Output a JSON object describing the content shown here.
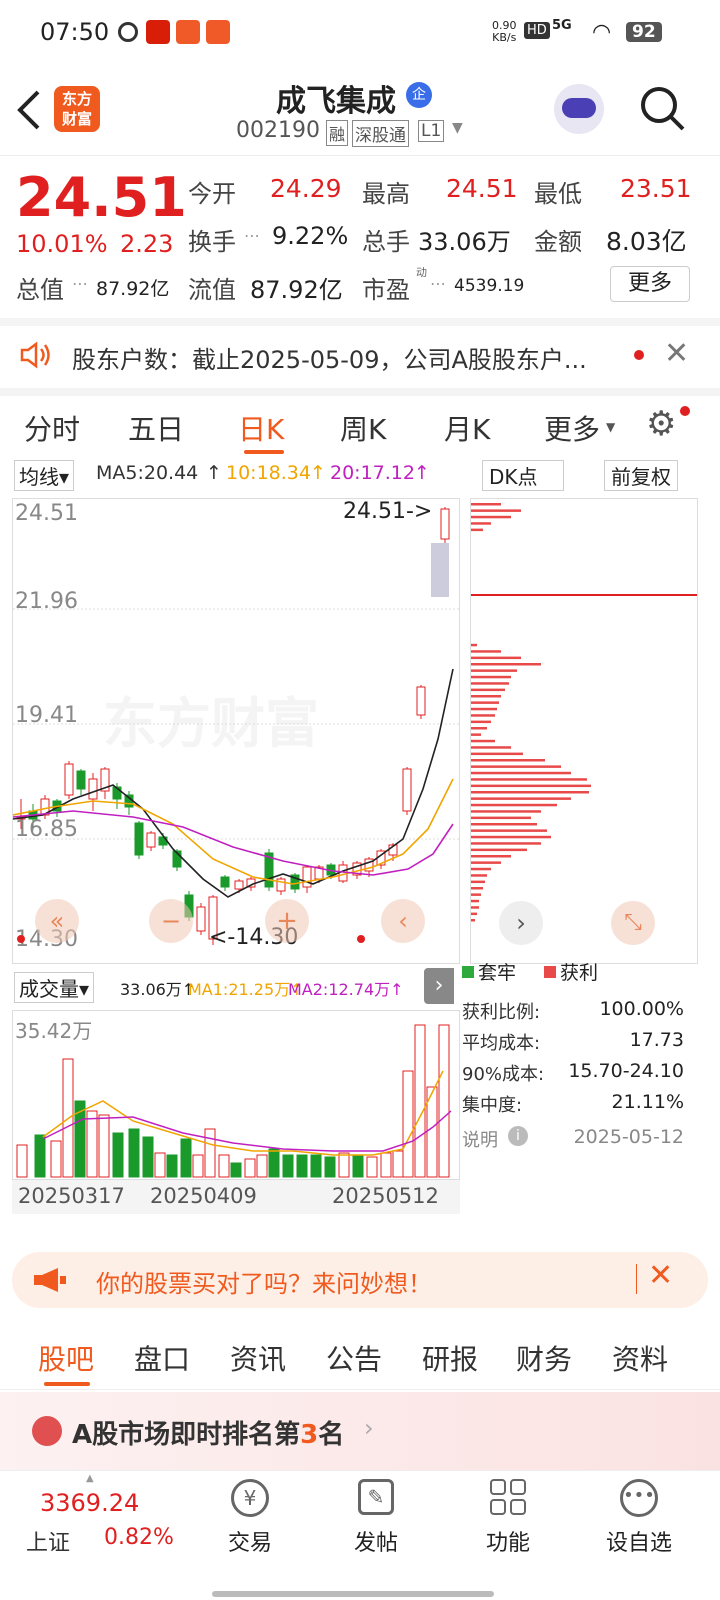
{
  "status": {
    "time": "07:50",
    "speed": "0.90",
    "speed_unit": "KB/s",
    "battery": "92",
    "net": "5G",
    "hd": "HD"
  },
  "header": {
    "logo_line1": "东方",
    "logo_line2": "财富",
    "title": "成飞集成",
    "title_badge": "企",
    "code": "002190",
    "tag1": "融",
    "tag2": "深股通",
    "tag3": "L1"
  },
  "quote": {
    "price": "24.51",
    "pct": "10.01%",
    "chg": "2.23",
    "open_label": "今开",
    "open": "24.29",
    "high_label": "最高",
    "high": "24.51",
    "low_label": "最低",
    "low": "23.51",
    "turnover_label": "换手",
    "turnover": "9.22%",
    "vol_label": "总手",
    "vol": "33.06万",
    "amt_label": "金额",
    "amt": "8.03亿",
    "mcap_label": "总值",
    "mcap": "87.92亿",
    "float_label": "流值",
    "float": "87.92亿",
    "pe_label": "市盈",
    "pe_sup": "动",
    "pe": "4539.19",
    "more": "更多"
  },
  "notice": {
    "text": "股东户数：截止2025-05-09，公司A股股东户..."
  },
  "tabs": [
    "分时",
    "五日",
    "日K",
    "周K",
    "月K",
    "更多"
  ],
  "kline": {
    "ma_label": "均线",
    "ma5": "MA5:20.44",
    "ma10": "10:18.34",
    "ma20": "20:17.12",
    "arrow": "↑",
    "dk": "DK点",
    "fq": "前复权",
    "yticks": [
      "24.51",
      "21.96",
      "19.41",
      "16.85",
      "14.30"
    ],
    "high_mark": "24.51->",
    "low_mark": "<-14.30",
    "watermark": "东方财富"
  },
  "dk": {
    "legend1": "套牢",
    "legend2": "获利",
    "rows": [
      [
        "获利比例:",
        "100.00%"
      ],
      [
        "平均成本:",
        "17.73"
      ],
      [
        "90%成本:",
        "15.70-24.10"
      ],
      [
        "集中度:",
        "21.11%"
      ]
    ],
    "note_label": "说明",
    "date": "2025-05-12"
  },
  "volume": {
    "label": "成交量",
    "v": "33.06万↑",
    "ma1": "MA1:21.25万↑",
    "ma2": "MA2:12.74万↑",
    "ymax": "35.42万",
    "dates": [
      "20250317",
      "20250409",
      "20250512"
    ]
  },
  "ann": {
    "text": "你的股票买对了吗？来问妙想！"
  },
  "subtabs": [
    "股吧",
    "盘口",
    "资讯",
    "公告",
    "研报",
    "财务",
    "资料"
  ],
  "rank": {
    "pre": "A股市场即时排名第",
    "num": "3",
    "post": "名"
  },
  "bottom": {
    "index_val": "3369.24",
    "index_name": "上证",
    "index_pct": "0.82%",
    "items": [
      "交易",
      "发帖",
      "功能",
      "设自选"
    ]
  }
}
